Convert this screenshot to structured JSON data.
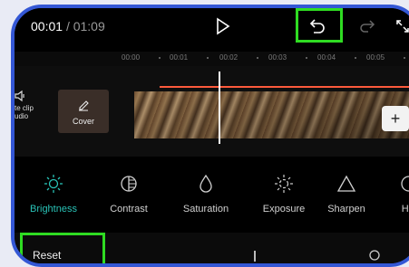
{
  "player": {
    "current_time": "00:01",
    "separator": "/",
    "duration": "01:09"
  },
  "ruler": [
    "00:00",
    "00:01",
    "00:02",
    "00:03",
    "00:04",
    "00:05"
  ],
  "timeline": {
    "mute_label_line1": "te clip",
    "mute_label_line2": "udio",
    "cover_label": "Cover",
    "add_label": "+"
  },
  "tools": [
    {
      "label": "Brightness",
      "icon": "brightness-icon",
      "active": true
    },
    {
      "label": "Contrast",
      "icon": "contrast-icon",
      "active": false
    },
    {
      "label": "Saturation",
      "icon": "saturation-icon",
      "active": false
    },
    {
      "label": "Exposure",
      "icon": "exposure-icon",
      "active": false
    },
    {
      "label": "Sharpen",
      "icon": "sharpen-icon",
      "active": false
    },
    {
      "label": "Hig",
      "icon": "highlights-icon",
      "active": false
    }
  ],
  "bottom": {
    "reset_label": "Reset"
  },
  "colors": {
    "accent": "#29c2b6",
    "frame": "#3457d5",
    "highlight": "#2fdc22",
    "track": "#ff5a3c"
  }
}
